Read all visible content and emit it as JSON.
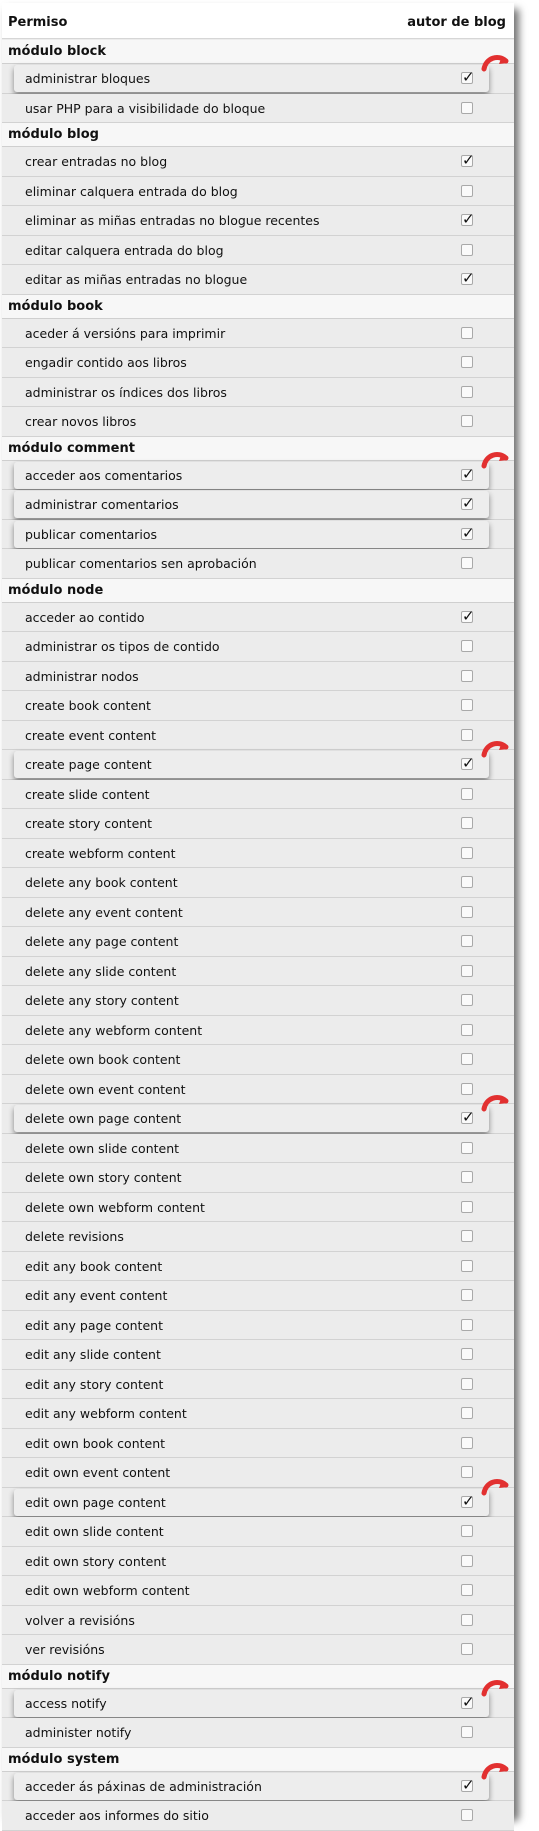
{
  "header": {
    "permission_col": "Permiso",
    "role_col": "autor de blog"
  },
  "modules": [
    {
      "label": "módulo block",
      "perms": [
        {
          "label": "administrar bloques",
          "checked": true,
          "highlight": true
        },
        {
          "label": "usar PHP para a visibilidade do bloque",
          "checked": false
        }
      ]
    },
    {
      "label": "módulo blog",
      "perms": [
        {
          "label": "crear entradas no blog",
          "checked": true
        },
        {
          "label": "eliminar calquera entrada do blog",
          "checked": false
        },
        {
          "label": "eliminar as miñas entradas no blogue recentes",
          "checked": true
        },
        {
          "label": "editar calquera entrada do blog",
          "checked": false
        },
        {
          "label": "editar as miñas entradas no blogue",
          "checked": true
        }
      ]
    },
    {
      "label": "módulo book",
      "perms": [
        {
          "label": "aceder á versións para imprimir",
          "checked": false
        },
        {
          "label": "engadir contido aos libros",
          "checked": false
        },
        {
          "label": "administrar os índices dos libros",
          "checked": false
        },
        {
          "label": "crear novos libros",
          "checked": false
        }
      ]
    },
    {
      "label": "módulo comment",
      "perms": [
        {
          "label": "acceder aos comentarios",
          "checked": true,
          "highlight": true,
          "group": "start"
        },
        {
          "label": "administrar comentarios",
          "checked": true,
          "highlight": true,
          "group": "mid"
        },
        {
          "label": "publicar comentarios",
          "checked": true,
          "highlight": true,
          "group": "end"
        },
        {
          "label": "publicar comentarios sen aprobación",
          "checked": false
        }
      ]
    },
    {
      "label": "módulo node",
      "perms": [
        {
          "label": "acceder ao contido",
          "checked": true
        },
        {
          "label": "administrar os tipos de contido",
          "checked": false
        },
        {
          "label": "administrar nodos",
          "checked": false
        },
        {
          "label": "create book content",
          "checked": false
        },
        {
          "label": "create event content",
          "checked": false
        },
        {
          "label": "create page content",
          "checked": true,
          "highlight": true
        },
        {
          "label": "create slide content",
          "checked": false
        },
        {
          "label": "create story content",
          "checked": false
        },
        {
          "label": "create webform content",
          "checked": false
        },
        {
          "label": "delete any book content",
          "checked": false
        },
        {
          "label": "delete any event content",
          "checked": false
        },
        {
          "label": "delete any page content",
          "checked": false
        },
        {
          "label": "delete any slide content",
          "checked": false
        },
        {
          "label": "delete any story content",
          "checked": false
        },
        {
          "label": "delete any webform content",
          "checked": false
        },
        {
          "label": "delete own book content",
          "checked": false
        },
        {
          "label": "delete own event content",
          "checked": false
        },
        {
          "label": "delete own page content",
          "checked": true,
          "highlight": true
        },
        {
          "label": "delete own slide content",
          "checked": false
        },
        {
          "label": "delete own story content",
          "checked": false
        },
        {
          "label": "delete own webform content",
          "checked": false
        },
        {
          "label": "delete revisions",
          "checked": false
        },
        {
          "label": "edit any book content",
          "checked": false
        },
        {
          "label": "edit any event content",
          "checked": false
        },
        {
          "label": "edit any page content",
          "checked": false
        },
        {
          "label": "edit any slide content",
          "checked": false
        },
        {
          "label": "edit any story content",
          "checked": false
        },
        {
          "label": "edit any webform content",
          "checked": false
        },
        {
          "label": "edit own book content",
          "checked": false
        },
        {
          "label": "edit own event content",
          "checked": false
        },
        {
          "label": "edit own page content",
          "checked": true,
          "highlight": true
        },
        {
          "label": "edit own slide content",
          "checked": false
        },
        {
          "label": "edit own story content",
          "checked": false
        },
        {
          "label": "edit own webform content",
          "checked": false
        },
        {
          "label": "volver a revisións",
          "checked": false
        },
        {
          "label": "ver revisións",
          "checked": false
        }
      ]
    },
    {
      "label": "módulo notify",
      "perms": [
        {
          "label": "access notify",
          "checked": true,
          "highlight": true
        },
        {
          "label": "administer notify",
          "checked": false
        }
      ]
    },
    {
      "label": "módulo system",
      "perms": [
        {
          "label": "acceder ás páxinas de administración",
          "checked": true,
          "highlight": true
        },
        {
          "label": "acceder aos informes do sitio",
          "checked": false
        }
      ]
    }
  ],
  "colors": {
    "background": "#ececec",
    "header": "#ffffff",
    "curl_accent": "#e23030"
  },
  "icons": {
    "checkbox": "checkbox-icon",
    "page_curl": "red-curl-arrow-icon"
  }
}
